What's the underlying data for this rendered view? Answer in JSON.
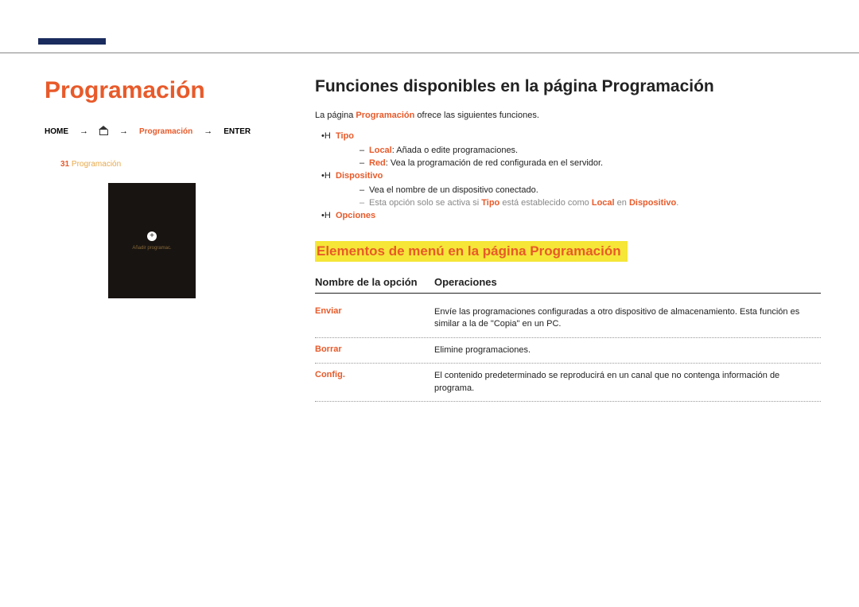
{
  "page_title": "Programación",
  "nav": {
    "home": "HOME",
    "prog": "Programación",
    "enter": "ENTER"
  },
  "thumb": {
    "num": "31",
    "label": "Programación",
    "button": "Añadir programac."
  },
  "section_heading": "Funciones disponibles en la página Programación",
  "intro_pre": "La página ",
  "intro_red": "Programación",
  "intro_post": " ofrece las siguientes funciones.",
  "bullets": {
    "tipo": {
      "label": "Tipo",
      "sub1_red": "Local",
      "sub1_post": ": Añada o edite programaciones.",
      "sub2_red": "Red",
      "sub2_post": ": Vea la programación de red configurada en el servidor.",
      "note_pre": "Esta opción solo se activa si ",
      "note_red1": "Tipo",
      "note_mid": " está establecido como ",
      "note_red2": "Local",
      "note_mid2": " en ",
      "note_red3": "Dispositivo",
      "note_post": "."
    },
    "dispositivo": {
      "label": "Dispositivo",
      "sub1": "Vea el nombre de un dispositivo conectado."
    },
    "opciones": {
      "label": "Opciones"
    }
  },
  "menu_section": "Elementos de menú en la página Programación",
  "table": {
    "h_name": "Nombre de la opción",
    "h_ops": "Operaciones",
    "rows": [
      {
        "opt": "Enviar",
        "desc": "Envíe las programaciones configuradas a otro dispositivo de almacenamiento. Esta función es similar a la de \"Copia\" en un PC."
      },
      {
        "opt": "Borrar",
        "desc": "Elimine programaciones."
      },
      {
        "opt": "Config.",
        "desc": "El contenido predeterminado se reproducirá en un canal que no contenga información de programa."
      }
    ]
  }
}
